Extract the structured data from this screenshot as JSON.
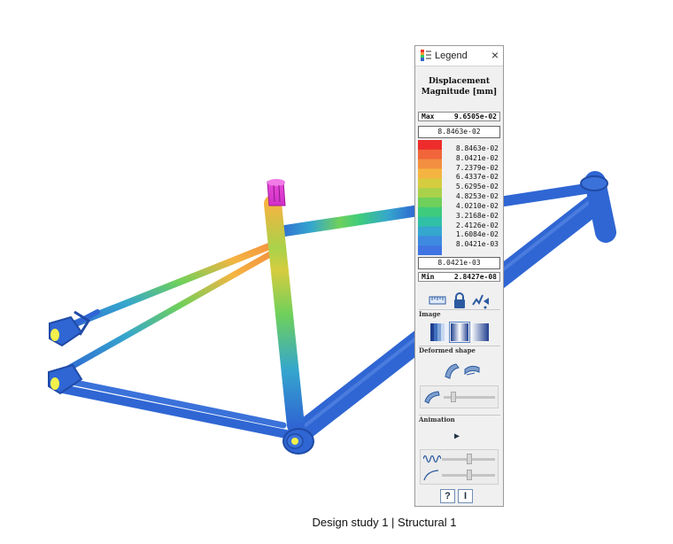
{
  "window": {
    "caption": "Design study 1 | Structural  1"
  },
  "legend": {
    "title": "Legend",
    "close_glyph": "×",
    "heading_line1": "Displacement",
    "heading_line2": "Magnitude [mm]",
    "max_label": "Max",
    "max_value": "9.6505e-02",
    "min_label": "Min",
    "min_value": "2.8427e-08",
    "upper_limit": "8.8463e-02",
    "lower_limit": "8.0421e-03",
    "scale": [
      {
        "label": "8.8463e-02",
        "color": "#ee2c2c"
      },
      {
        "label": "8.0421e-02",
        "color": "#f0653a"
      },
      {
        "label": "7.2379e-02",
        "color": "#f38f40"
      },
      {
        "label": "6.4337e-02",
        "color": "#f5b441"
      },
      {
        "label": "5.6295e-02",
        "color": "#d6cc3f"
      },
      {
        "label": "4.8253e-02",
        "color": "#a9d24a"
      },
      {
        "label": "4.0210e-02",
        "color": "#6fd05b"
      },
      {
        "label": "3.2168e-02",
        "color": "#3ecb7d"
      },
      {
        "label": "2.4126e-02",
        "color": "#2fc0a5"
      },
      {
        "label": "1.6084e-02",
        "color": "#35a6cd"
      },
      {
        "label": "8.0421e-03",
        "color": "#3d8ae0"
      },
      {
        "label": "",
        "color": "#3f74e2"
      }
    ],
    "icons": [
      "ruler-icon",
      "lock-icon",
      "probe-icon"
    ],
    "sections": {
      "image": "Image",
      "deformed": "Deformed shape",
      "animation": "Animation"
    },
    "play_glyph": "▶",
    "help_glyph": "?",
    "extra_glyph": "I"
  },
  "colors": {
    "frame_base": "#2f66d3",
    "frame_dark": "#1f4aa6",
    "seat_clamp": "#e23fd5",
    "accent_yellow": "#f2f04a"
  }
}
